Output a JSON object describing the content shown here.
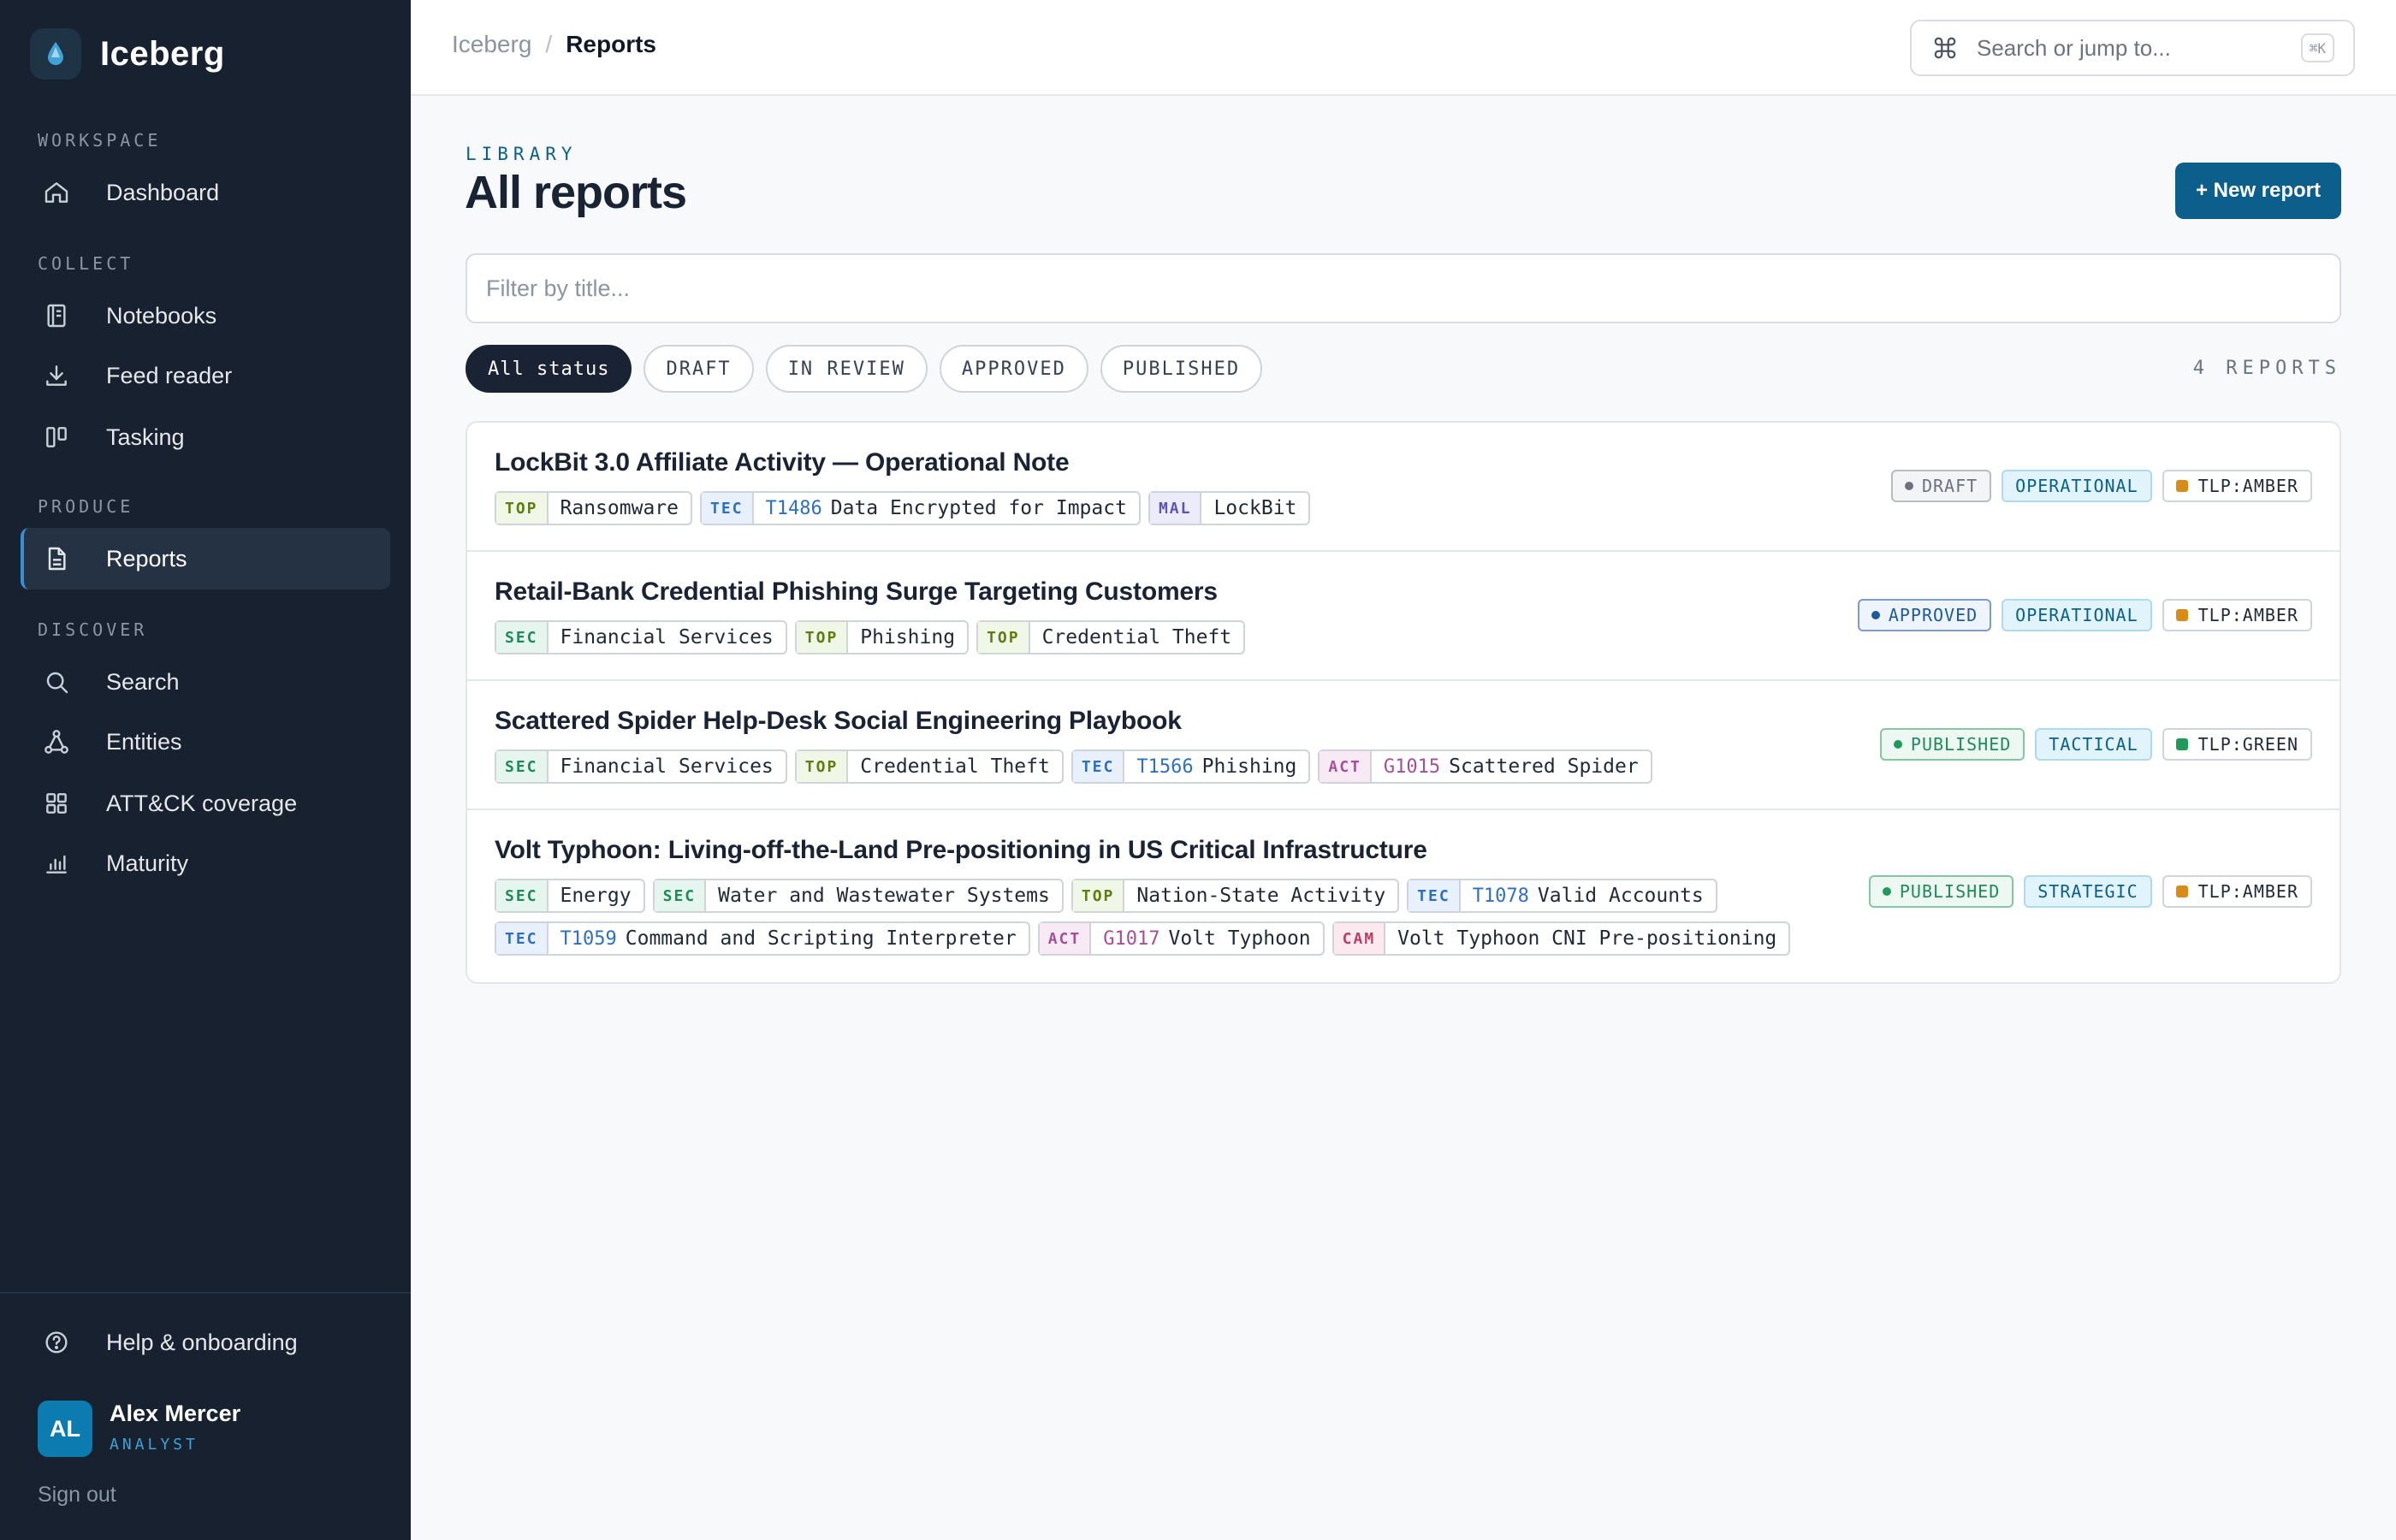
{
  "app": {
    "name": "Iceberg"
  },
  "sidebar": {
    "sections": [
      "WORKSPACE",
      "COLLECT",
      "PRODUCE",
      "DISCOVER"
    ],
    "items": [
      {
        "label": "Dashboard",
        "icon": "home-icon"
      },
      {
        "label": "Notebooks",
        "icon": "notebook-icon"
      },
      {
        "label": "Feed reader",
        "icon": "download-icon"
      },
      {
        "label": "Tasking",
        "icon": "kanban-icon"
      },
      {
        "label": "Reports",
        "icon": "document-icon",
        "active": true
      },
      {
        "label": "Search",
        "icon": "search-icon"
      },
      {
        "label": "Entities",
        "icon": "graph-icon"
      },
      {
        "label": "ATT&CK coverage",
        "icon": "grid-icon"
      },
      {
        "label": "Maturity",
        "icon": "bar-chart-icon"
      }
    ],
    "help": "Help & onboarding",
    "user": {
      "initials": "AL",
      "name": "Alex Mercer",
      "role": "ANALYST"
    },
    "sign_out": "Sign out"
  },
  "topbar": {
    "breadcrumb": {
      "root": "Iceberg",
      "separator": "/",
      "current": "Reports"
    },
    "search": {
      "placeholder": "Search or jump to...",
      "shortcut": "⌘K"
    }
  },
  "main": {
    "eyebrow": "LIBRARY",
    "title": "All reports",
    "new_button": "+ New report",
    "filter_placeholder": "Filter by title...",
    "status_filters": [
      "All status",
      "DRAFT",
      "IN REVIEW",
      "APPROVED",
      "PUBLISHED"
    ],
    "count": "4 REPORTS"
  },
  "reports": [
    {
      "title": "LockBit 3.0 Affiliate Activity — Operational Note",
      "tags": [
        [
          {
            "type": "TOP",
            "value": "Ransomware"
          },
          {
            "type": "TEC",
            "id": "T1486",
            "value": "Data Encrypted for Impact"
          },
          {
            "type": "MAL",
            "value": "LockBit"
          }
        ]
      ],
      "status": "DRAFT",
      "level": "OPERATIONAL",
      "tlp": "TLP:AMBER"
    },
    {
      "title": "Retail-Bank Credential Phishing Surge Targeting Customers",
      "tags": [
        [
          {
            "type": "SEC",
            "value": "Financial Services"
          },
          {
            "type": "TOP",
            "value": "Phishing"
          },
          {
            "type": "TOP",
            "value": "Credential Theft"
          }
        ]
      ],
      "status": "APPROVED",
      "level": "OPERATIONAL",
      "tlp": "TLP:AMBER"
    },
    {
      "title": "Scattered Spider Help-Desk Social Engineering Playbook",
      "tags": [
        [
          {
            "type": "SEC",
            "value": "Financial Services"
          },
          {
            "type": "TOP",
            "value": "Credential Theft"
          },
          {
            "type": "TEC",
            "id": "T1566",
            "value": "Phishing"
          },
          {
            "type": "ACT",
            "id": "G1015",
            "value": "Scattered Spider"
          }
        ]
      ],
      "status": "PUBLISHED",
      "level": "TACTICAL",
      "tlp": "TLP:GREEN"
    },
    {
      "title": "Volt Typhoon: Living-off-the-Land Pre-positioning in US Critical Infrastructure",
      "tags": [
        [
          {
            "type": "SEC",
            "value": "Energy"
          },
          {
            "type": "SEC",
            "value": "Water and Wastewater Systems"
          },
          {
            "type": "TOP",
            "value": "Nation-State Activity"
          },
          {
            "type": "TEC",
            "id": "T1078",
            "value": "Valid Accounts"
          }
        ],
        [
          {
            "type": "TEC",
            "id": "T1059",
            "value": "Command and Scripting Interpreter"
          },
          {
            "type": "ACT",
            "id": "G1017",
            "value": "Volt Typhoon"
          },
          {
            "type": "CAM",
            "value": "Volt Typhoon CNI Pre-positioning"
          }
        ]
      ],
      "status": "PUBLISHED",
      "level": "STRATEGIC",
      "tlp": "TLP:AMBER"
    }
  ],
  "colors": {
    "sidebar_bg": "#172130",
    "accent": "#0b5f8a",
    "tlp_amber": "#d98b1a",
    "tlp_green": "#1f9a5b"
  }
}
